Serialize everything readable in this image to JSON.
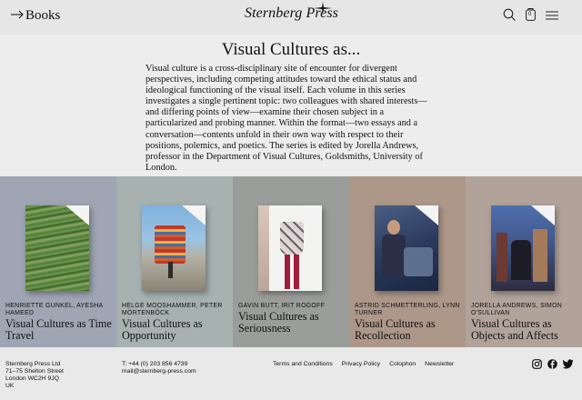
{
  "header": {
    "back_label": "Books",
    "logo_text": "Sternberg Press"
  },
  "page": {
    "title": "Visual Cultures as...",
    "description": "Visual culture is a cross-disciplinary site of encounter for divergent perspectives, including competing attitudes toward the ethical status and ideological functioning of the visual itself. Each volume in this series investigates a single pertinent topic: two colleagues with shared interests—and differing points of view—examine their chosen subject in a particularized and probing manner. Within the format—two essays and a conversation—contents unfold in their own way with respect to their positions, polemics, and poetics. The series is edited by Jorella Andrews, professor in the Department of Visual Cultures, Goldsmiths, University of London."
  },
  "books": [
    {
      "authors": "Henriette Gunkel, Ayesha Hameed",
      "title": "Visual Cultures as Time Travel",
      "bg": "#9fa5b3"
    },
    {
      "authors": "Helge Mooshammer, Peter Mörtenböck",
      "title": "Visual Cultures as Opportunity",
      "bg": "#a6b1b0"
    },
    {
      "authors": "Gavin Butt, Irit Rogoff",
      "title": "Visual Cultures as Seriousness",
      "bg": "#9b9d9b"
    },
    {
      "authors": "Astrid Schmetterling, Lynn Turner",
      "title": "Visual Cultures as Recollection",
      "bg": "#ac9789"
    },
    {
      "authors": "Jorella Andrews, Simon O'Sullivan",
      "title": "Visual Cultures as Objects and Affects",
      "bg": "#b1a39a"
    }
  ],
  "footer": {
    "address": [
      "Sternberg Press Ltd",
      "71–75 Shelton Street",
      "London WC2H 9JQ",
      "UK"
    ],
    "phone": "T: +44 (0) 203 856 4739",
    "email": "mail@sternberg-press.com",
    "links": [
      "Terms and Conditions",
      "Privacy Policy",
      "Colophon",
      "Newsletter"
    ]
  },
  "icons": {
    "search": "search-icon",
    "cart": "cart-icon",
    "menu": "menu-icon",
    "cart_count": "0"
  }
}
